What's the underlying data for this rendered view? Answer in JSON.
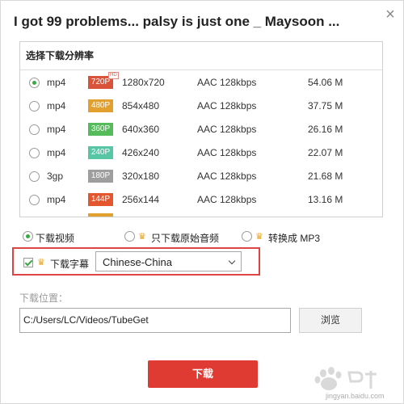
{
  "dialog": {
    "title": "I got 99 problems... palsy is just one _ Maysoon ...",
    "close_glyph": "×"
  },
  "resolution_panel": {
    "header": "选择下载分辨率",
    "hd_tag": "HD",
    "rows": [
      {
        "format": "mp4",
        "quality": "720P",
        "resolution": "1280x720",
        "audio": "AAC 128kbps",
        "size": "54.06 M",
        "badge_color": "#d9533a",
        "selected": true
      },
      {
        "format": "mp4",
        "quality": "480P",
        "resolution": "854x480",
        "audio": "AAC 128kbps",
        "size": "37.75 M",
        "badge_color": "#e2a12f",
        "selected": false
      },
      {
        "format": "mp4",
        "quality": "360P",
        "resolution": "640x360",
        "audio": "AAC 128kbps",
        "size": "26.16 M",
        "badge_color": "#55bb5b",
        "selected": false
      },
      {
        "format": "mp4",
        "quality": "240P",
        "resolution": "426x240",
        "audio": "AAC 128kbps",
        "size": "22.07 M",
        "badge_color": "#56c6a4",
        "selected": false
      },
      {
        "format": "3gp",
        "quality": "180P",
        "resolution": "320x180",
        "audio": "AAC 128kbps",
        "size": "21.68 M",
        "badge_color": "#9e9e9e",
        "selected": false
      },
      {
        "format": "mp4",
        "quality": "144P",
        "resolution": "256x144",
        "audio": "AAC 128kbps",
        "size": "13.16 M",
        "badge_color": "#e4572e",
        "selected": false
      }
    ]
  },
  "options": {
    "download_video": "下载视频",
    "download_audio_only": "只下载原始音频",
    "convert_mp3": "转换成 MP3",
    "selected": "download_video"
  },
  "subtitles": {
    "checkbox_label": "下载字幕",
    "checked": true,
    "language": "Chinese-China"
  },
  "location": {
    "label": "下载位置：",
    "path": "C:/Users/LC/Videos/TubeGet",
    "browse_label": "浏览"
  },
  "actions": {
    "download_label": "下载"
  },
  "watermark": {
    "text": "jingyan.baidu.com"
  },
  "colors": {
    "accent_red": "#df3b33",
    "highlight_border": "#e04343",
    "radio_green": "#3aa843",
    "crown_gold": "#e8a317"
  }
}
